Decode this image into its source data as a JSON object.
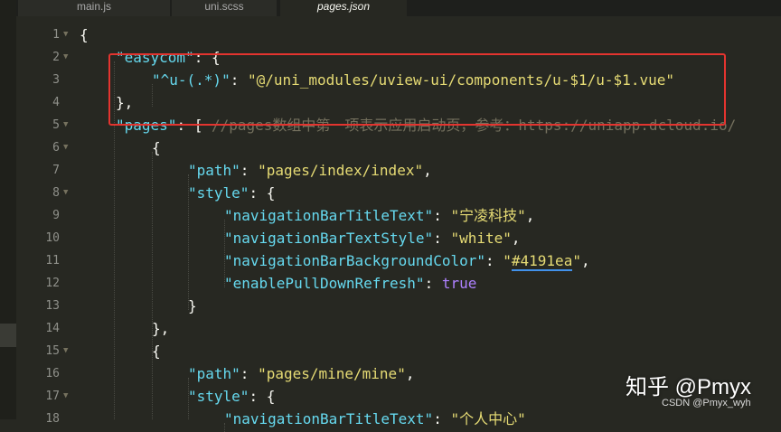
{
  "tabs": [
    {
      "label": "main.js",
      "active": false
    },
    {
      "label": "uni.scss",
      "active": false
    },
    {
      "label": "pages.json",
      "active": true
    }
  ],
  "editor": {
    "lines": [
      {
        "num": "1"
      },
      {
        "num": "2",
        "t1": "\"easycom\"",
        "t2": ": {"
      },
      {
        "num": "3",
        "t1": "\"^u-(.*)\"",
        "t2": ": ",
        "t3": "\"@/uni_modules/uview-ui/components/u-$1/u-$1.vue\""
      },
      {
        "num": "4",
        "t1": "},"
      },
      {
        "num": "5",
        "t1": "\"pages\"",
        "t2": ": [ ",
        "t3": "//pages数组中第一项表示应用启动页，参考：https://uniapp.dcloud.io/"
      },
      {
        "num": "6",
        "t1": "{"
      },
      {
        "num": "7",
        "t1": "\"path\"",
        "t2": ": ",
        "t3": "\"pages/index/index\"",
        "t4": ","
      },
      {
        "num": "8",
        "t1": "\"style\"",
        "t2": ": {"
      },
      {
        "num": "9",
        "t1": "\"navigationBarTitleText\"",
        "t2": ": ",
        "t3": "\"宁凌科技\"",
        "t4": ","
      },
      {
        "num": "10",
        "t1": "\"navigationBarTextStyle\"",
        "t2": ": ",
        "t3": "\"white\"",
        "t4": ","
      },
      {
        "num": "11",
        "t1": "\"navigationBarBackgroundColor\"",
        "t2": ": ",
        "t3q": "\"",
        "t3": "#4191ea",
        "t3e": "\"",
        "t4": ","
      },
      {
        "num": "12",
        "t1": "\"enablePullDownRefresh\"",
        "t2": ": ",
        "t3": "true"
      },
      {
        "num": "13",
        "t1": "}"
      },
      {
        "num": "14",
        "t1": "},"
      },
      {
        "num": "15",
        "t1": "{"
      },
      {
        "num": "16",
        "t1": "\"path\"",
        "t2": ": ",
        "t3": "\"pages/mine/mine\"",
        "t4": ","
      },
      {
        "num": "17",
        "t1": "\"style\"",
        "t2": ": {"
      },
      {
        "num": "18",
        "t1": "\"navigationBarTitleText\"",
        "t2": ": ",
        "t3": "\"个人中心\""
      }
    ],
    "line1_brace": "{"
  },
  "watermark": {
    "main": "知乎 @Pmyx",
    "sub": "CSDN @Pmyx_wyh"
  },
  "colors": {
    "background": "#272822",
    "key": "#66d9ef",
    "string": "#e6db74",
    "comment": "#75715e",
    "boolean": "#ae81ff",
    "highlight_box": "#e3342f",
    "underline": "#4191ea"
  }
}
